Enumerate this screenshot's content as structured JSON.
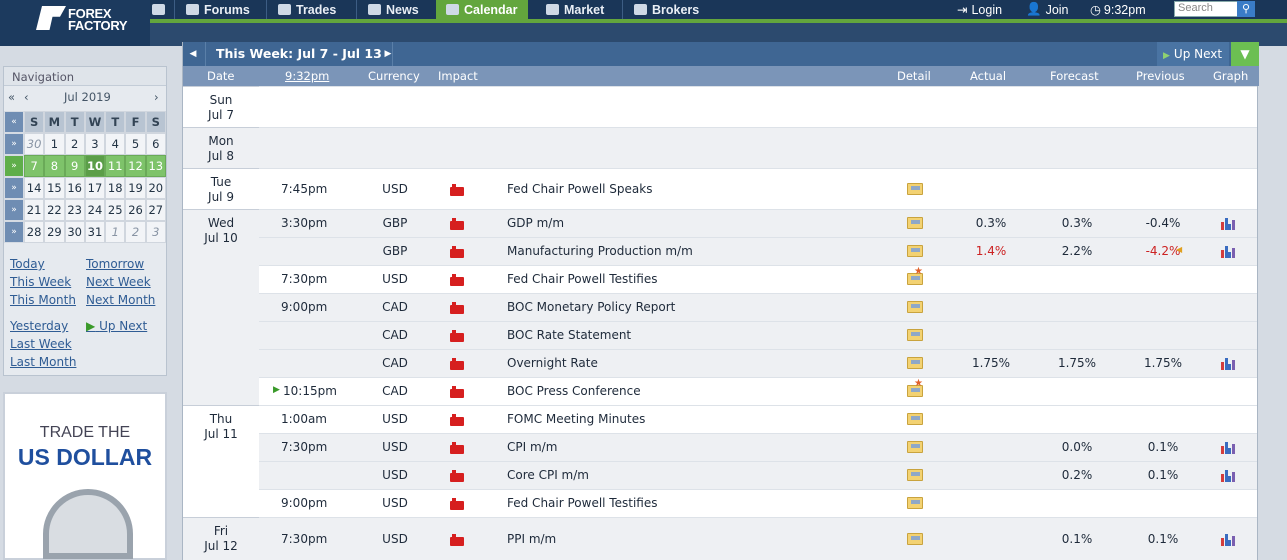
{
  "header": {
    "logo": {
      "line1": "FOREX",
      "line2": "FACTORY"
    },
    "nav": [
      {
        "label": "Forums",
        "icon": "forums-icon"
      },
      {
        "label": "Trades",
        "icon": "trades-icon"
      },
      {
        "label": "News",
        "icon": "news-icon"
      },
      {
        "label": "Calendar",
        "icon": "calendar-icon",
        "active": true
      },
      {
        "label": "Market",
        "icon": "market-icon"
      },
      {
        "label": "Brokers",
        "icon": "brokers-icon"
      }
    ],
    "login": "Login",
    "join": "Join",
    "time": "9:32pm",
    "search_placeholder": "Search",
    "accent_color": "#63a63d"
  },
  "sidebar": {
    "title": "Navigation",
    "month": "Jul 2019",
    "weekdays": [
      "S",
      "M",
      "T",
      "W",
      "T",
      "F",
      "S"
    ],
    "weeks": [
      [
        "30",
        "1",
        "2",
        "3",
        "4",
        "5",
        "6"
      ],
      [
        "7",
        "8",
        "9",
        "10",
        "11",
        "12",
        "13"
      ],
      [
        "14",
        "15",
        "16",
        "17",
        "18",
        "19",
        "20"
      ],
      [
        "21",
        "22",
        "23",
        "24",
        "25",
        "26",
        "27"
      ],
      [
        "28",
        "29",
        "30",
        "31",
        "1",
        "2",
        "3"
      ]
    ],
    "links1": [
      "Today",
      "This Week",
      "This Month"
    ],
    "links2": [
      "Tomorrow",
      "Next Week",
      "Next Month"
    ],
    "links3": [
      "Yesterday",
      "Last Week",
      "Last Month"
    ],
    "up_next": "Up Next"
  },
  "ad": {
    "line1": "TRADE THE",
    "line2": "US DOLLAR"
  },
  "calendar": {
    "week_title": "This Week: Jul 7 - Jul 13",
    "up_next": "Up Next",
    "columns": {
      "date": "Date",
      "time": "9:32pm",
      "currency": "Currency",
      "impact": "Impact",
      "detail": "Detail",
      "actual": "Actual",
      "forecast": "Forecast",
      "previous": "Previous",
      "graph": "Graph"
    },
    "days": [
      {
        "dow": "Sun",
        "date": "Jul 7"
      },
      {
        "dow": "Mon",
        "date": "Jul 8"
      },
      {
        "dow": "Tue",
        "date": "Jul 9"
      },
      {
        "dow": "Wed",
        "date": "Jul 10"
      },
      {
        "dow": "Thu",
        "date": "Jul 11"
      },
      {
        "dow": "Fri",
        "date": "Jul 12"
      }
    ],
    "events": [
      {
        "time": "7:45pm",
        "currency": "USD",
        "event": "Fed Chair Powell Speaks",
        "actual": "",
        "forecast": "",
        "previous": ""
      },
      {
        "time": "3:30pm",
        "currency": "GBP",
        "event": "GDP m/m",
        "actual": "0.3%",
        "forecast": "0.3%",
        "previous": "-0.4%"
      },
      {
        "time": "",
        "currency": "GBP",
        "event": "Manufacturing Production m/m",
        "actual": "1.4%",
        "forecast": "2.2%",
        "previous": "-4.2%"
      },
      {
        "time": "7:30pm",
        "currency": "USD",
        "event": "Fed Chair Powell Testifies",
        "actual": "",
        "forecast": "",
        "previous": ""
      },
      {
        "time": "9:00pm",
        "currency": "CAD",
        "event": "BOC Monetary Policy Report",
        "actual": "",
        "forecast": "",
        "previous": ""
      },
      {
        "time": "",
        "currency": "CAD",
        "event": "BOC Rate Statement",
        "actual": "",
        "forecast": "",
        "previous": ""
      },
      {
        "time": "",
        "currency": "CAD",
        "event": "Overnight Rate",
        "actual": "1.75%",
        "forecast": "1.75%",
        "previous": "1.75%"
      },
      {
        "time": "10:15pm",
        "currency": "CAD",
        "event": "BOC Press Conference",
        "actual": "",
        "forecast": "",
        "previous": ""
      },
      {
        "time": "1:00am",
        "currency": "USD",
        "event": "FOMC Meeting Minutes",
        "actual": "",
        "forecast": "",
        "previous": ""
      },
      {
        "time": "7:30pm",
        "currency": "USD",
        "event": "CPI m/m",
        "actual": "",
        "forecast": "0.0%",
        "previous": "0.1%"
      },
      {
        "time": "",
        "currency": "USD",
        "event": "Core CPI m/m",
        "actual": "",
        "forecast": "0.2%",
        "previous": "0.1%"
      },
      {
        "time": "9:00pm",
        "currency": "USD",
        "event": "Fed Chair Powell Testifies",
        "actual": "",
        "forecast": "",
        "previous": ""
      },
      {
        "time": "7:30pm",
        "currency": "USD",
        "event": "PPI m/m",
        "actual": "",
        "forecast": "0.1%",
        "previous": "0.1%"
      }
    ],
    "impact_color": "#d61f1f",
    "negative_color": "#cc2222"
  }
}
